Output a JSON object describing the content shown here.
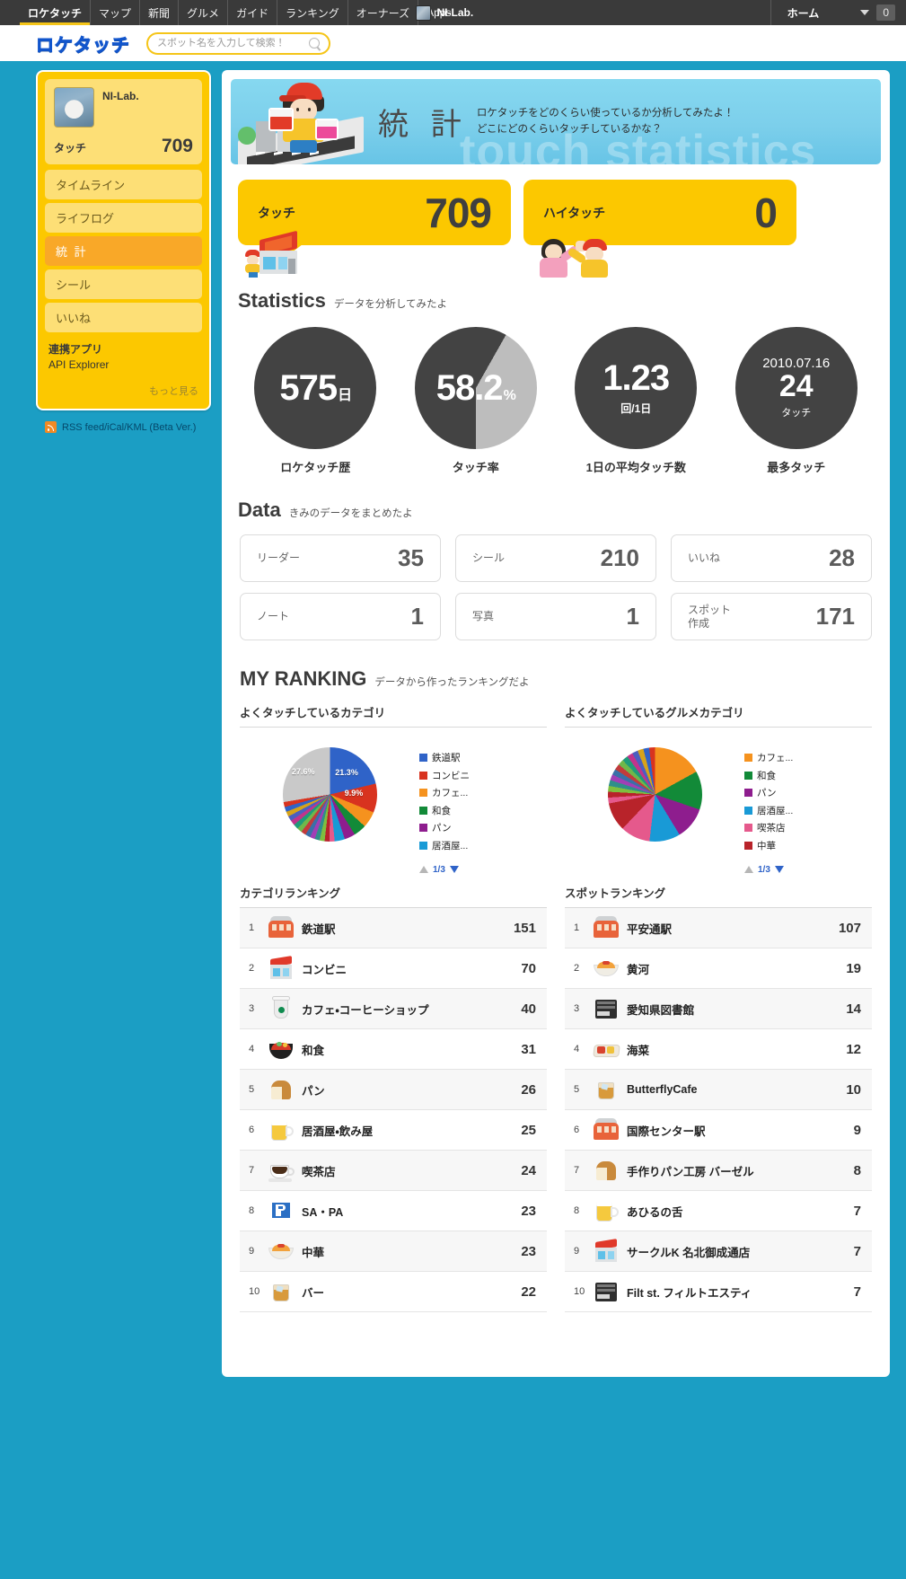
{
  "topnav": {
    "items": [
      "ロケタッチ",
      "マップ",
      "新聞",
      "グルメ",
      "ガイド",
      "ランキング",
      "オーナーズ",
      "Apps"
    ],
    "username": "NI-Lab.",
    "home_label": "ホーム",
    "count": "0"
  },
  "header": {
    "logo": "ロケタッチ",
    "search_placeholder": "スポット名を入力して検索！",
    "search_value": ""
  },
  "sidebar": {
    "profile": {
      "name": "NI-Lab.",
      "touch_label": "タッチ",
      "touch_value": "709"
    },
    "items": [
      {
        "label": "タイムライン",
        "active": false
      },
      {
        "label": "ライフログ",
        "active": false
      },
      {
        "label": "統 計",
        "active": true
      },
      {
        "label": "シール",
        "active": false
      },
      {
        "label": "いいね",
        "active": false
      }
    ],
    "apps_title": "連携アプリ",
    "apps_link": "API Explorer",
    "more_label": "もっと見る",
    "rss_label": "RSS feed/iCal/KML (Beta Ver.)"
  },
  "banner": {
    "title": "統 計",
    "sub_line1": "ロケタッチをどのくらい使っているか分析してみたよ！",
    "sub_line2": "どこにどのくらいタッチしているかな？",
    "ghost": "touch statistics"
  },
  "touch_panels": [
    {
      "label": "タッチ",
      "value": "709"
    },
    {
      "label": "ハイタッチ",
      "value": "0"
    }
  ],
  "statistics": {
    "heading": "Statistics",
    "sub": "データを分析してみたよ",
    "circles": [
      {
        "value": "575",
        "unit": "日",
        "sub": "",
        "label": "ロケタッチ歴",
        "type": "plain"
      },
      {
        "value": "58.2",
        "unit": "%",
        "sub": "",
        "label": "タッチ率",
        "type": "pct",
        "percent": 58.2
      },
      {
        "value": "1.23",
        "unit": "",
        "sub": "回/1日",
        "label": "1日の平均タッチ数",
        "type": "plain"
      },
      {
        "top": "2010.07.16",
        "value": "24",
        "unit": "",
        "sub": "タッチ",
        "label": "最多タッチ",
        "type": "date"
      }
    ]
  },
  "data": {
    "heading": "Data",
    "sub": "きみのデータをまとめたよ",
    "boxes": [
      {
        "label": "リーダー",
        "value": "35"
      },
      {
        "label": "シール",
        "value": "210"
      },
      {
        "label": "いいね",
        "value": "28"
      },
      {
        "label": "ノート",
        "value": "1"
      },
      {
        "label": "写真",
        "value": "1"
      },
      {
        "label": "スポット\n作成",
        "value": "171"
      }
    ]
  },
  "my_ranking": {
    "heading": "MY RANKING",
    "sub": "データから作ったランキングだよ",
    "pager_label": "1/3"
  },
  "chart_data": [
    {
      "type": "pie",
      "title": "よくタッチしているカテゴリ",
      "categories": [
        "鉄道駅",
        "コンビニ",
        "カフェ...",
        "和食",
        "パン",
        "居酒屋..."
      ],
      "values": [
        21.3,
        9.9,
        5.6,
        4.4,
        3.7,
        3.5
      ],
      "other_value": 27.6,
      "labels_shown": [
        "21.3%",
        "9.9%",
        "27.6%"
      ],
      "colors": [
        "#2f63c8",
        "#d8331f",
        "#f5921e",
        "#128a38",
        "#8e1d8e",
        "#199ad6"
      ],
      "other_color": "#c9c9c9",
      "legend_position": "right"
    },
    {
      "type": "pie",
      "title": "よくタッチしているグルメカテゴリ",
      "categories": [
        "カフェ...",
        "和食",
        "パン",
        "居酒屋...",
        "喫茶店",
        "中華"
      ],
      "values": [
        17.0,
        13.2,
        11.1,
        10.6,
        10.2,
        9.8
      ],
      "colors": [
        "#f5921e",
        "#128a38",
        "#8e1d8e",
        "#199ad6",
        "#e5598c",
        "#b8232a"
      ],
      "legend_position": "right"
    }
  ],
  "rankings": [
    {
      "title": "カテゴリランキング",
      "rows": [
        {
          "rank": "1",
          "name": "鉄道駅",
          "value": "151",
          "icon": "train-icon"
        },
        {
          "rank": "2",
          "name": "コンビニ",
          "value": "70",
          "icon": "store-icon"
        },
        {
          "rank": "3",
          "name": "カフェ・コーヒーショップ",
          "value": "40",
          "icon": "cup-icon"
        },
        {
          "rank": "4",
          "name": "和食",
          "value": "31",
          "icon": "bowl-icon"
        },
        {
          "rank": "5",
          "name": "パン",
          "value": "26",
          "icon": "bread-icon"
        },
        {
          "rank": "6",
          "name": "居酒屋・飲み屋",
          "value": "25",
          "icon": "beer-icon"
        },
        {
          "rank": "7",
          "name": "喫茶店",
          "value": "24",
          "icon": "coffee-icon"
        },
        {
          "rank": "8",
          "name": "SA・PA",
          "value": "23",
          "icon": "parking-icon"
        },
        {
          "rank": "9",
          "name": "中華",
          "value": "23",
          "icon": "noodle-icon"
        },
        {
          "rank": "10",
          "name": "バー",
          "value": "22",
          "icon": "whisky-icon"
        }
      ]
    },
    {
      "title": "スポットランキング",
      "rows": [
        {
          "rank": "1",
          "name": "平安通駅",
          "value": "107",
          "icon": "train-icon"
        },
        {
          "rank": "2",
          "name": "黄河",
          "value": "19",
          "icon": "noodle-icon"
        },
        {
          "rank": "3",
          "name": "愛知県図書館",
          "value": "14",
          "icon": "book-icon"
        },
        {
          "rank": "4",
          "name": "海菜",
          "value": "12",
          "icon": "bento-icon"
        },
        {
          "rank": "5",
          "name": "ButterflyCafe",
          "value": "10",
          "icon": "whisky-icon"
        },
        {
          "rank": "6",
          "name": "国際センター駅",
          "value": "9",
          "icon": "train-icon"
        },
        {
          "rank": "7",
          "name": "手作りパン工房 バーゼル",
          "value": "8",
          "icon": "bread-icon"
        },
        {
          "rank": "8",
          "name": "あひるの舌",
          "value": "7",
          "icon": "beer-icon"
        },
        {
          "rank": "9",
          "name": "サークルK 名北御成通店",
          "value": "7",
          "icon": "store-icon"
        },
        {
          "rank": "10",
          "name": "Filt st. フィルトエスティ",
          "value": "7",
          "icon": "book-icon"
        }
      ]
    }
  ]
}
